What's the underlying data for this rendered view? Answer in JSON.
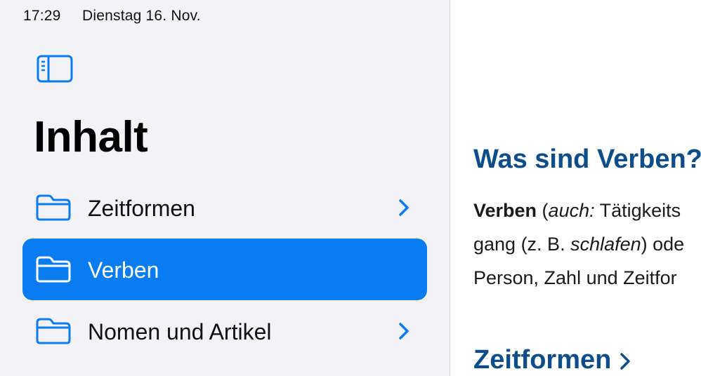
{
  "status_bar": {
    "time": "17:29",
    "date": "Dienstag 16. Nov."
  },
  "sidebar": {
    "toggle_icon": "sidebar-icon",
    "title": "Inhalt",
    "items": [
      {
        "label": "Zeitformen",
        "icon": "folder-icon",
        "selected": false,
        "has_chevron": true
      },
      {
        "label": "Verben",
        "icon": "folder-icon",
        "selected": true,
        "has_chevron": false
      },
      {
        "label": "Nomen und Artikel",
        "icon": "folder-icon",
        "selected": false,
        "has_chevron": true
      }
    ]
  },
  "content": {
    "heading": "Was sind Verben?",
    "paragraph": {
      "line1": {
        "bold": "Verben",
        "t1": " (",
        "italic": "auch:",
        "t2": " Tätigkeits"
      },
      "line2": {
        "t1": "gang (z. B. ",
        "italic": "schlafen",
        "t2": ") ode"
      },
      "line3": {
        "t1": "Person, Zahl und Zeitfor"
      }
    },
    "link": "Zeitformen"
  },
  "colors": {
    "accent": "#0a7cf2",
    "heading": "#0d4d8c",
    "sidebar_bg": "#f2f2f7"
  }
}
